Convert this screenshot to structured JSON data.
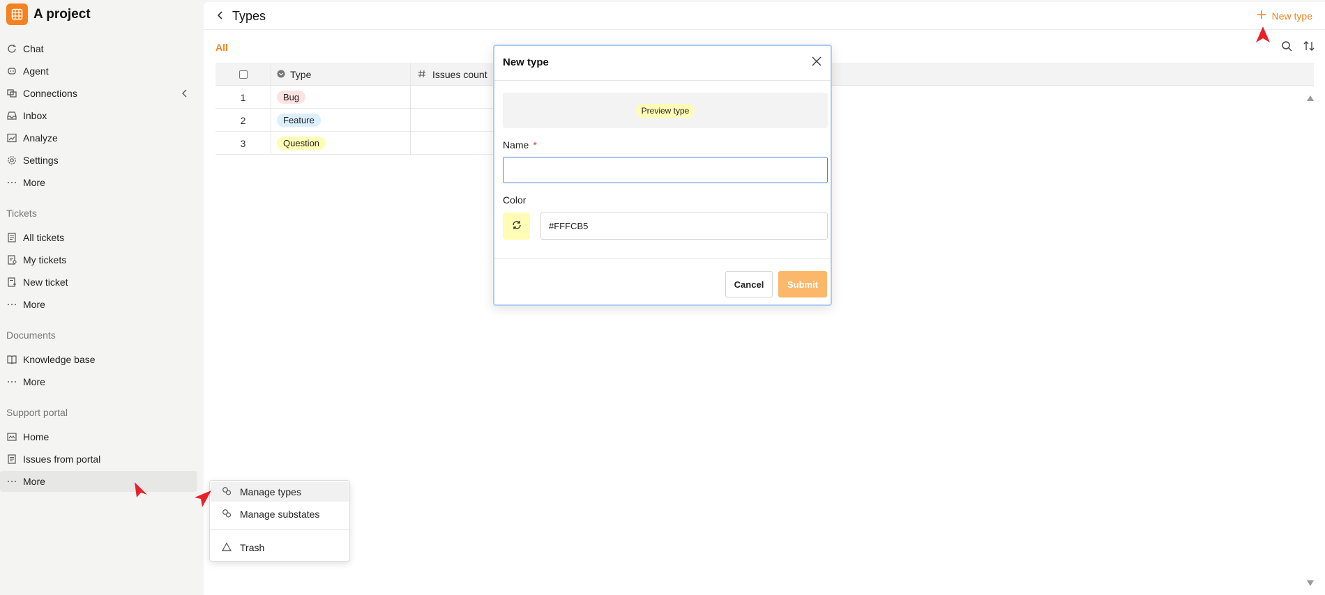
{
  "brand": {
    "name": "A project",
    "logo_icon": "grid-icon",
    "accent": "#f5821f"
  },
  "sidebar": {
    "top_items": [
      {
        "label": "Chat",
        "icon": "chat-icon"
      },
      {
        "label": "Agent",
        "icon": "agent-icon"
      },
      {
        "label": "Connections",
        "icon": "connections-icon"
      },
      {
        "label": "Inbox",
        "icon": "inbox-icon"
      },
      {
        "label": "Analyze",
        "icon": "analyze-icon"
      },
      {
        "label": "Settings",
        "icon": "gear-icon"
      },
      {
        "label": "More",
        "icon": "more-icon"
      }
    ],
    "tickets": {
      "title": "Tickets",
      "items": [
        {
          "label": "All tickets",
          "icon": "tickets-icon"
        },
        {
          "label": "My tickets",
          "icon": "my-tickets-icon"
        },
        {
          "label": "New ticket",
          "icon": "new-ticket-icon"
        },
        {
          "label": "More",
          "icon": "more-icon"
        }
      ]
    },
    "documents": {
      "title": "Documents",
      "items": [
        {
          "label": "Knowledge base",
          "icon": "book-icon"
        },
        {
          "label": "More",
          "icon": "more-icon"
        }
      ]
    },
    "portal": {
      "title": "Support portal",
      "items": [
        {
          "label": "Home",
          "icon": "home-icon"
        },
        {
          "label": "Issues from portal",
          "icon": "issues-icon"
        },
        {
          "label": "More",
          "icon": "more-icon"
        }
      ]
    }
  },
  "header": {
    "title": "Types",
    "new_button": "New type"
  },
  "toolbar": {
    "filter": "All"
  },
  "table": {
    "columns": [
      "Type",
      "Issues count"
    ],
    "rows": [
      {
        "num": "1",
        "type": "Bug",
        "color": "#fde2e2"
      },
      {
        "num": "2",
        "type": "Feature",
        "color": "#dcefff"
      },
      {
        "num": "3",
        "type": "Question",
        "color": "#fffcb5"
      }
    ]
  },
  "modal": {
    "title": "New type",
    "preview_label": "Preview type",
    "name_label": "Name",
    "required_mark": "*",
    "name_value": "",
    "color_label": "Color",
    "color_value": "#FFFCB5",
    "cancel": "Cancel",
    "submit": "Submit"
  },
  "popup_menu": {
    "items": [
      {
        "label": "Manage types",
        "icon": "manage-types-icon"
      },
      {
        "label": "Manage substates",
        "icon": "manage-substates-icon"
      },
      {
        "label": "Trash",
        "icon": "trash-icon"
      }
    ]
  }
}
